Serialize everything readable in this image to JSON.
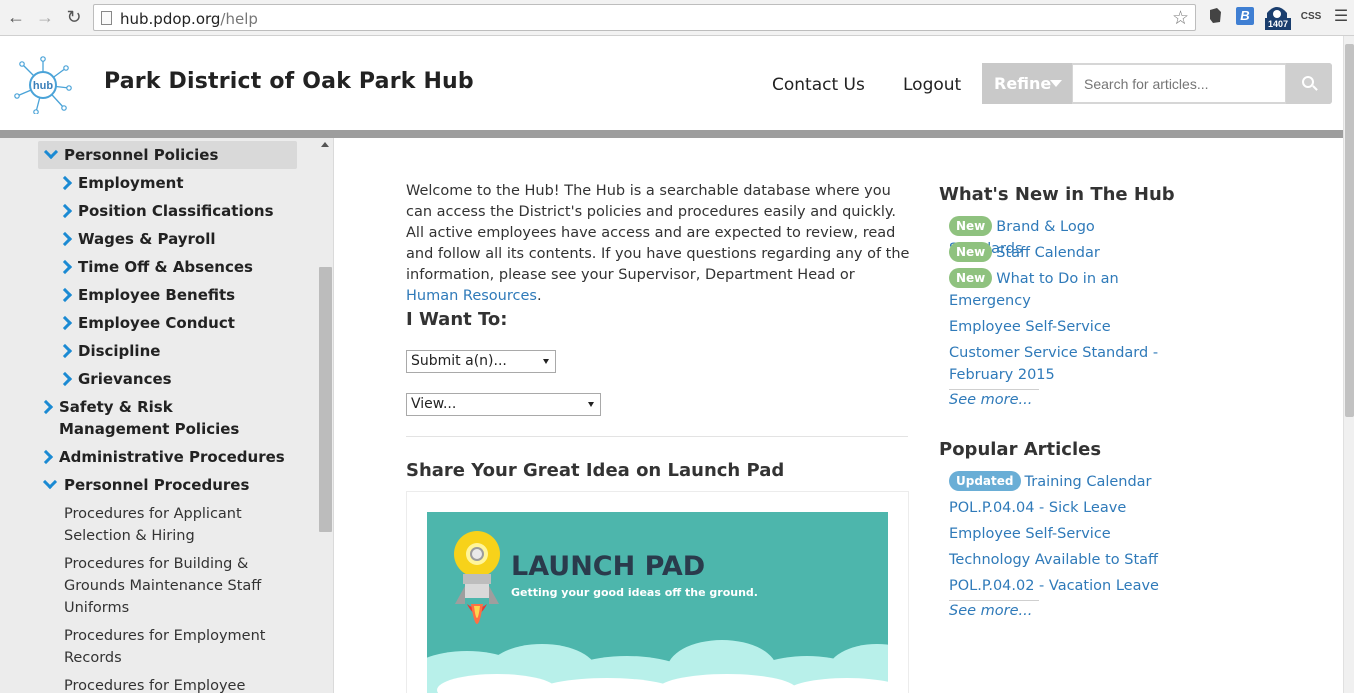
{
  "browser": {
    "url_host": "hub.pdop.org",
    "url_path": "/help",
    "ext_badge": "1407",
    "ext_css": "CSS"
  },
  "header": {
    "title": "Park District of Oak Park Hub",
    "logo_text": "hub",
    "nav": [
      "Contact Us",
      "Logout"
    ],
    "refine_label": "Refine",
    "search_placeholder": "Search for articles..."
  },
  "sidebar": {
    "items": [
      {
        "label": "Personnel Policies",
        "level": 0,
        "state": "expanded",
        "selected": true
      },
      {
        "label": "Employment",
        "level": 1,
        "state": "collapsed"
      },
      {
        "label": "Position Classifications",
        "level": 1,
        "state": "collapsed"
      },
      {
        "label": "Wages & Payroll",
        "level": 1,
        "state": "collapsed"
      },
      {
        "label": "Time Off & Absences",
        "level": 1,
        "state": "collapsed"
      },
      {
        "label": "Employee Benefits",
        "level": 1,
        "state": "collapsed"
      },
      {
        "label": "Employee Conduct",
        "level": 1,
        "state": "collapsed"
      },
      {
        "label": "Discipline",
        "level": 1,
        "state": "collapsed"
      },
      {
        "label": "Grievances",
        "level": 1,
        "state": "collapsed"
      },
      {
        "label": "Safety & Risk Management Policies",
        "level": 0,
        "state": "collapsed"
      },
      {
        "label": "Administrative Procedures",
        "level": 0,
        "state": "collapsed"
      },
      {
        "label": "Personnel Procedures",
        "level": 0,
        "state": "expanded"
      }
    ],
    "pages": [
      "Procedures for Applicant Selection & Hiring",
      "Procedures for Building & Grounds Maintenance Staff Uniforms",
      "Procedures for Employment Records",
      "Procedures for Employee"
    ]
  },
  "main": {
    "intro_text": "Welcome to the Hub! The Hub is a searchable database where you can access the District's policies and procedures easily and quickly. All active employees have access and are expected to review, read and follow all its contents. If you have questions regarding any of the information, please see your Supervisor, Department Head or ",
    "intro_link": "Human Resources",
    "intro_end": ".",
    "want_heading": "I Want To:",
    "select_submit": "Submit a(n)...",
    "select_view": "View...",
    "share_heading": "Share Your Great Idea on Launch Pad",
    "banner_title": "LAUNCH PAD",
    "banner_subtitle": "Getting your good ideas off the ground."
  },
  "whats_new": {
    "heading": "What's New in The Hub",
    "items": [
      {
        "badge": "New",
        "text": "Brand & Logo Standards"
      },
      {
        "badge": "New",
        "text": "Staff Calendar"
      },
      {
        "badge": "New",
        "text": "What to Do in an Emergency"
      },
      {
        "badge": "",
        "text": "Employee Self-Service"
      },
      {
        "badge": "",
        "text": "Customer Service Standard - February 2015"
      }
    ],
    "see_more": "See more..."
  },
  "popular": {
    "heading": "Popular Articles",
    "items": [
      {
        "badge": "Updated",
        "text": "Training Calendar"
      },
      {
        "badge": "",
        "text": "POL.P.04.04 - Sick Leave"
      },
      {
        "badge": "",
        "text": "Employee Self-Service"
      },
      {
        "badge": "",
        "text": "Technology Available to Staff"
      },
      {
        "badge": "",
        "text": "POL.P.04.02 - Vacation Leave"
      }
    ],
    "see_more": "See more..."
  }
}
